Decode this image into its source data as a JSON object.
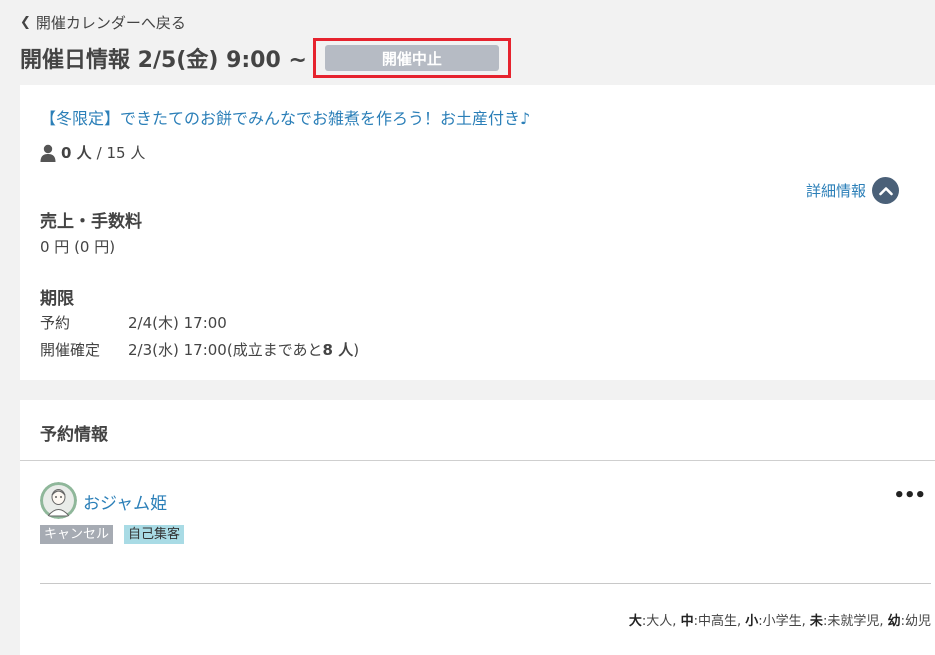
{
  "back": {
    "label": "開催カレンダーへ戻る"
  },
  "header": {
    "title": "開催日情報 2/5(金) 9:00 ~",
    "status": "開催中止"
  },
  "event": {
    "title": "【冬限定】できたてのお餅でみんなでお雑煮を作ろう！お土産付き♪",
    "participants": "0 人",
    "capacity_suffix": "/ 15 人",
    "detail_link": "詳細情報"
  },
  "fees": {
    "heading": "売上・手数料",
    "value": "0 円 (0 円)"
  },
  "deadline": {
    "heading": "期限",
    "rows": [
      {
        "label": "予約",
        "value": "2/4(木) 17:00"
      },
      {
        "label": "開催確定",
        "value_prefix": "2/3(水) 17:00(成立まであと",
        "value_bold": "8 人",
        "value_suffix": ")"
      }
    ]
  },
  "reservations": {
    "heading": "予約情報",
    "items": [
      {
        "name": "おジャム姫",
        "tags": [
          "キャンセル",
          "自己集客"
        ]
      }
    ],
    "more": "•••"
  },
  "legend": [
    {
      "key": "大",
      "text": ":大人, "
    },
    {
      "key": "中",
      "text": ":中高生, "
    },
    {
      "key": "小",
      "text": ":小学生, "
    },
    {
      "key": "未",
      "text": ":未就学児, "
    },
    {
      "key": "幼",
      "text": ":幼児"
    }
  ],
  "colors": {
    "background": "#f2f2f2",
    "link": "#2b7fb8",
    "status_badge": "#b6bbc4",
    "highlight_border": "#e6232e",
    "cancel_tag": "#a6abb3",
    "self_tag": "#a9dbe5",
    "detail_circle": "#4a6078"
  },
  "icons": {
    "back": "chevron-left-icon",
    "person": "person-icon",
    "detail_toggle": "chevron-up-icon",
    "avatar": "user-avatar",
    "more": "more-horizontal-icon"
  }
}
